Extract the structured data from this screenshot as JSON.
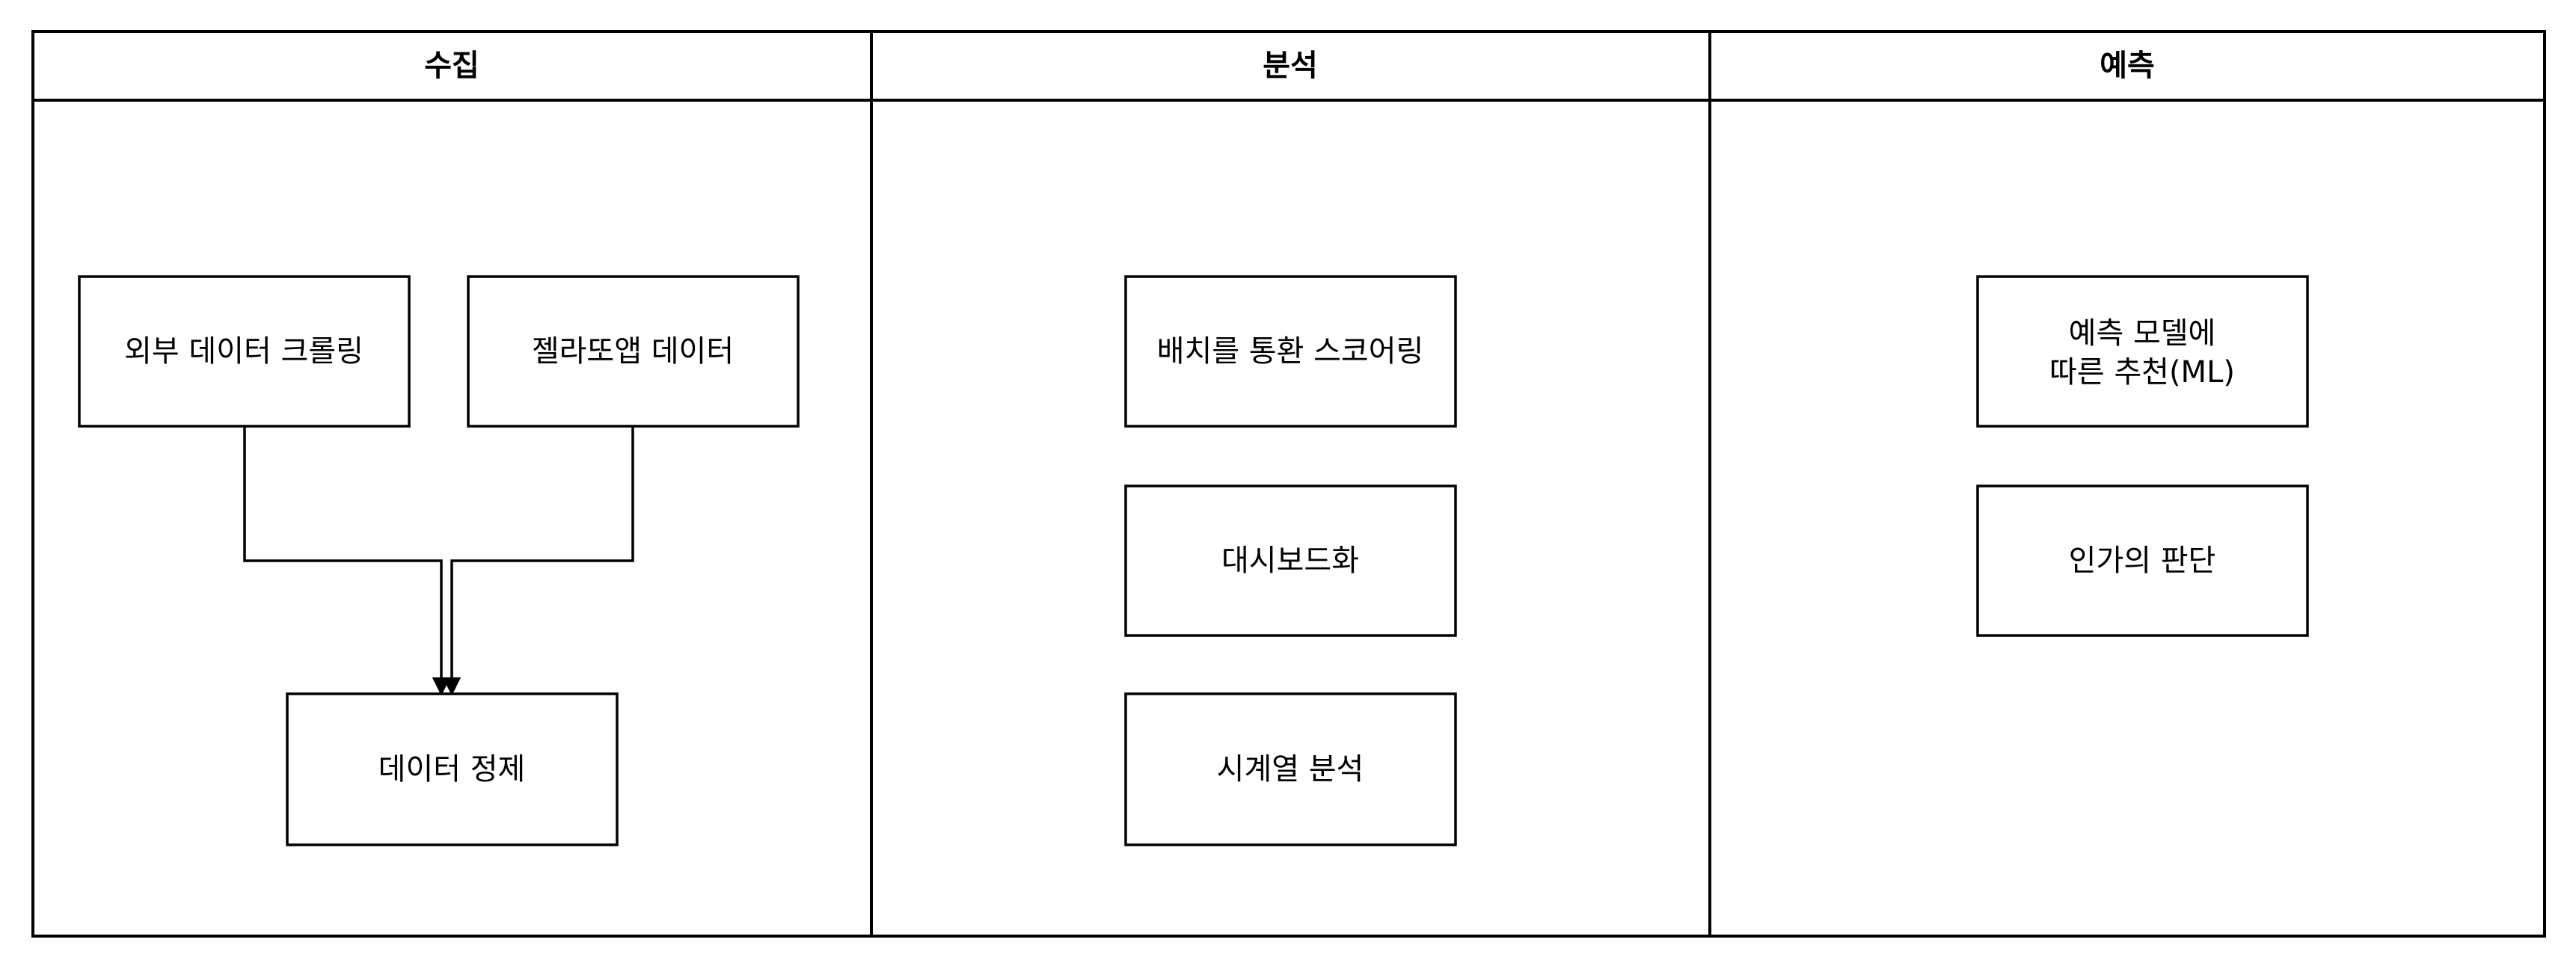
{
  "lanes": [
    {
      "title": "수집"
    },
    {
      "title": "분석"
    },
    {
      "title": "예측"
    }
  ],
  "collect": {
    "external_crawling": "외부 데이터 크롤링",
    "zelatoapp_data": "젤라또앱 데이터",
    "data_cleansing": "데이터 정제"
  },
  "analysis": {
    "batch_scoring": "배치를 통환 스코어링",
    "dashboard": "대시보드화",
    "time_series": "시계열 분석"
  },
  "prediction": {
    "ml_recommend_line1": "예측 모델에",
    "ml_recommend_line2": "따른 추천(ML)",
    "human_judgment": "인가의 판단"
  }
}
